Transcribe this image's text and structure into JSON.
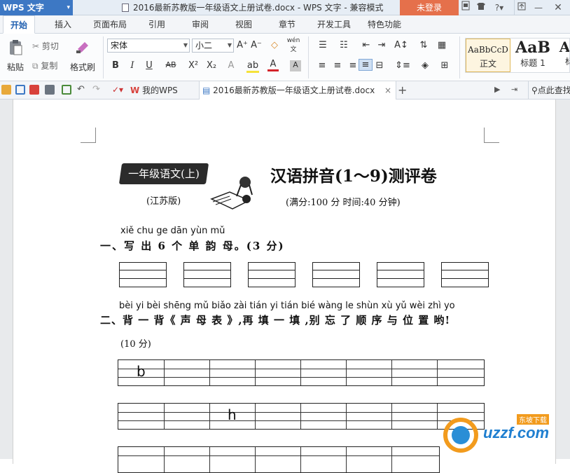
{
  "titlebar": {
    "app_name": "WPS 文字",
    "document_title": "2016最新苏教版一年级语文上册试卷.docx - WPS 文字 - 兼容模式",
    "login_label": "未登录",
    "icons": [
      "skin-icon",
      "tshirt-icon",
      "help-icon",
      "restore-icon",
      "close-icon"
    ]
  },
  "menu_tabs": [
    "开始",
    "插入",
    "页面布局",
    "引用",
    "审阅",
    "视图",
    "章节",
    "开发工具",
    "特色功能"
  ],
  "ribbon": {
    "paste_label": "粘贴",
    "cut_label": "剪切",
    "copy_label": "复制",
    "format_painter_label": "格式刷",
    "font_name": "宋体",
    "font_size": "小二",
    "bold": "B",
    "italic": "I",
    "underline": "U",
    "strikethrough": "AB",
    "superscript": "X²",
    "subscript": "X₂",
    "font_color_glyph": "A",
    "highlight_glyph": "ab",
    "pinyin_glyph": "wén",
    "styles": [
      {
        "preview": "AaBbCcD",
        "label": "正文"
      },
      {
        "preview": "AaB",
        "label": "标题 1"
      },
      {
        "preview": "Aa",
        "label": "标"
      }
    ]
  },
  "quickbar": {
    "home_tab": "我的WPS",
    "doc_tab": "2016最新苏教版一年级语文上册试卷.docx",
    "doc_tab_close": "×",
    "new_tab": "+",
    "search_label": "点此查找"
  },
  "document": {
    "banner": "一年级语文(上)",
    "edition": "(江苏版)",
    "title": "汉语拼音(1～9)测评卷",
    "meta": "(满分:100 分   时间:40 分钟)",
    "q1_pinyin": "xiě chu    ge dān yùn mǔ",
    "q1": "一、写 出  6 个 单 韵 母。(3 分)",
    "q2_pinyin": "bèi yi bèi   shēng mǔ biǎo    zài tián  yi  tián    bié wàng  le  shùn xù  yǔ  wèi zhì yo",
    "q2": "二、背 一 背《 声  母 表 》,再 填 一 填 ,别  忘  了 顺 序 与 位 置 哟!",
    "q2_points": "(10 分)",
    "row1_letter": "b",
    "row2_letter": "h"
  },
  "watermark": {
    "brand": "uzzf.com",
    "tag": "东坡下载"
  }
}
